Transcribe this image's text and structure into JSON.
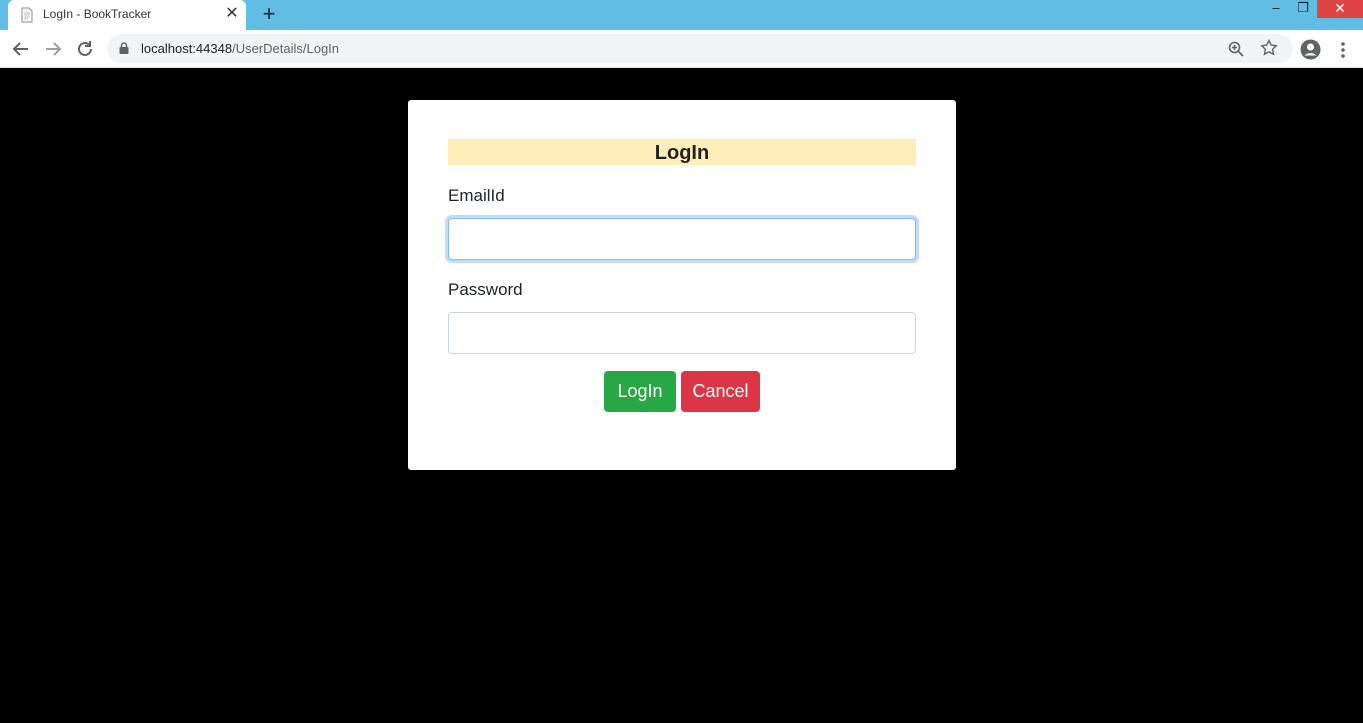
{
  "browser": {
    "tab_title": "LogIn - BookTracker",
    "tab_close": "✕",
    "new_tab": "+",
    "url_host": "localhost:44348",
    "url_path": "/UserDetails/LogIn",
    "window_controls": {
      "minimize": "–",
      "maximize": "❐",
      "close": "✕"
    }
  },
  "form": {
    "heading": "LogIn",
    "email_label": "EmailId",
    "email_value": "",
    "password_label": "Password",
    "password_value": "",
    "login_button": "LogIn",
    "cancel_button": "Cancel"
  },
  "colors": {
    "heading_bg": "#ffeeba",
    "login_button": "#28a745",
    "cancel_button": "#dc3545",
    "titlebar": "#62bde4"
  }
}
